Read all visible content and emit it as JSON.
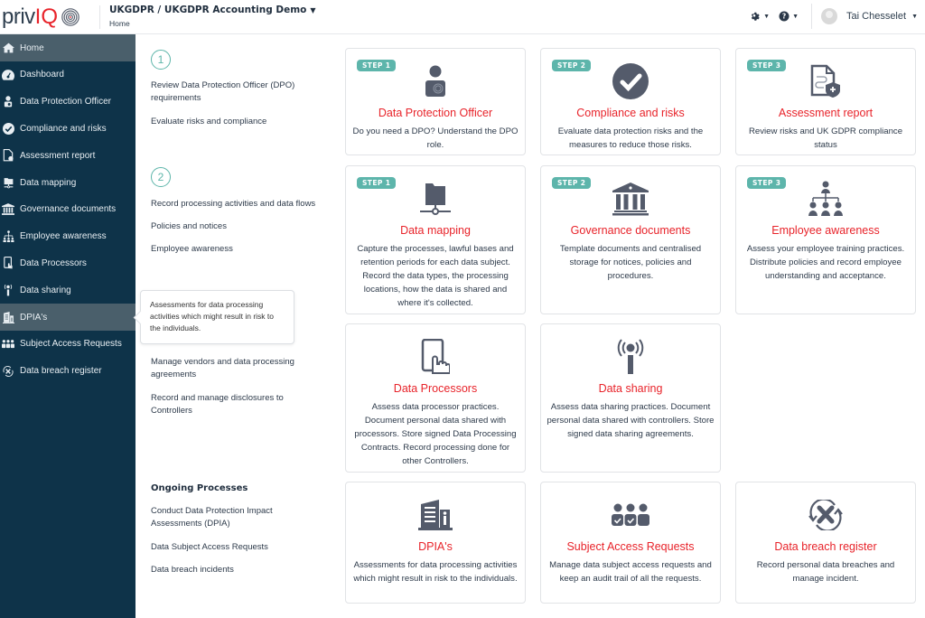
{
  "app": {
    "logo_text_a": "priv",
    "logo_text_b": "IQ",
    "org_title": "UKGDPR / UKGDPR Accounting Demo",
    "breadcrumb": "Home",
    "user_name": "Tai Chesselet"
  },
  "colors": {
    "sidebar_bg": "#0e3349",
    "sidebar_active": "#4a5f6b",
    "accent_red": "#e8232a",
    "badge_teal": "#5db5ab",
    "icon_gray": "#545b6b"
  },
  "sidebar": {
    "items": [
      {
        "label": "Home",
        "icon": "home-icon"
      },
      {
        "label": "Dashboard",
        "icon": "dashboard-icon"
      },
      {
        "label": "Data Protection Officer",
        "icon": "user-badge-icon"
      },
      {
        "label": "Compliance and risks",
        "icon": "check-circle-icon"
      },
      {
        "label": "Assessment report",
        "icon": "report-icon"
      },
      {
        "label": "Data mapping",
        "icon": "folder-network-icon"
      },
      {
        "label": "Governance documents",
        "icon": "bank-icon"
      },
      {
        "label": "Employee awareness",
        "icon": "org-chart-icon"
      },
      {
        "label": "Data Processors",
        "icon": "tablet-touch-icon"
      },
      {
        "label": "Data sharing",
        "icon": "broadcast-icon"
      },
      {
        "label": "DPIA's",
        "icon": "building-info-icon"
      },
      {
        "label": "Subject Access Requests",
        "icon": "users-check-icon"
      },
      {
        "label": "Data breach register",
        "icon": "breach-icon"
      }
    ]
  },
  "left": {
    "step1": "1",
    "step2": "2",
    "items": [
      "Review Data Protection Officer (DPO) requirements",
      "Evaluate risks and compliance",
      "Record processing activities and data flows",
      "Policies and notices",
      "Employee awareness",
      "Manage vendors and data processing agreements",
      "Record and manage disclosures to Controllers"
    ],
    "ongoing_heading": "Ongoing Processes",
    "ongoing": [
      "Conduct Data Protection Impact Assessments (DPIA)",
      "Data Subject Access Requests",
      "Data breach incidents"
    ]
  },
  "tooltip": "Assessments for data processing activities which might result in risk to the individuals.",
  "cards": [
    {
      "badge": "STEP 1",
      "title": "Data Protection Officer",
      "desc": "Do you need a DPO? Understand the DPO role."
    },
    {
      "badge": "STEP 2",
      "title": "Compliance and risks",
      "desc": "Evaluate data protection risks and the measures to reduce those risks."
    },
    {
      "badge": "STEP 3",
      "title": "Assessment report",
      "desc": "Review risks and UK GDPR compliance status"
    },
    {
      "badge": "STEP 1",
      "title": "Data mapping",
      "desc": "Capture the processes, lawful bases and retention periods for each data subject. Record the data types, the processing locations, how the data is shared and where it's collected."
    },
    {
      "badge": "STEP 2",
      "title": "Governance documents",
      "desc": "Template documents and centralised storage for notices, policies and procedures."
    },
    {
      "badge": "STEP 3",
      "title": "Employee awareness",
      "desc": "Assess your employee training practices. Distribute policies and record employee understanding and acceptance."
    },
    {
      "badge": "",
      "title": "Data Processors",
      "desc": "Assess data processor practices. Document personal data shared with processors. Store signed Data Processing Contracts. Record processing done for other Controllers."
    },
    {
      "badge": "",
      "title": "Data sharing",
      "desc": "Assess data sharing practices. Document personal data shared with controllers. Store signed data sharing agreements."
    },
    {
      "badge": "",
      "title": "DPIA's",
      "desc": "Assessments for data processing activities which might result in risk to the individuals."
    },
    {
      "badge": "",
      "title": "Subject Access Requests",
      "desc": "Manage data subject access requests and keep an audit trail of all the requests."
    },
    {
      "badge": "",
      "title": "Data breach register",
      "desc": "Record personal data breaches and manage incident."
    }
  ]
}
